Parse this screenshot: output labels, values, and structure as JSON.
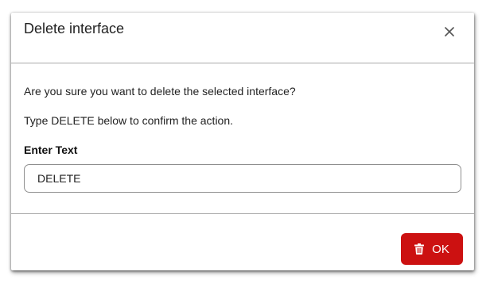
{
  "dialog": {
    "title": "Delete interface",
    "close_icon": "close-icon",
    "question": "Are you sure you want to delete the selected interface?",
    "instruction": "Type DELETE below to confirm the action.",
    "field_label": "Enter Text",
    "field_value": "DELETE",
    "ok_label": "OK",
    "ok_icon": "trash-icon",
    "accent_color": "#cc1111"
  }
}
